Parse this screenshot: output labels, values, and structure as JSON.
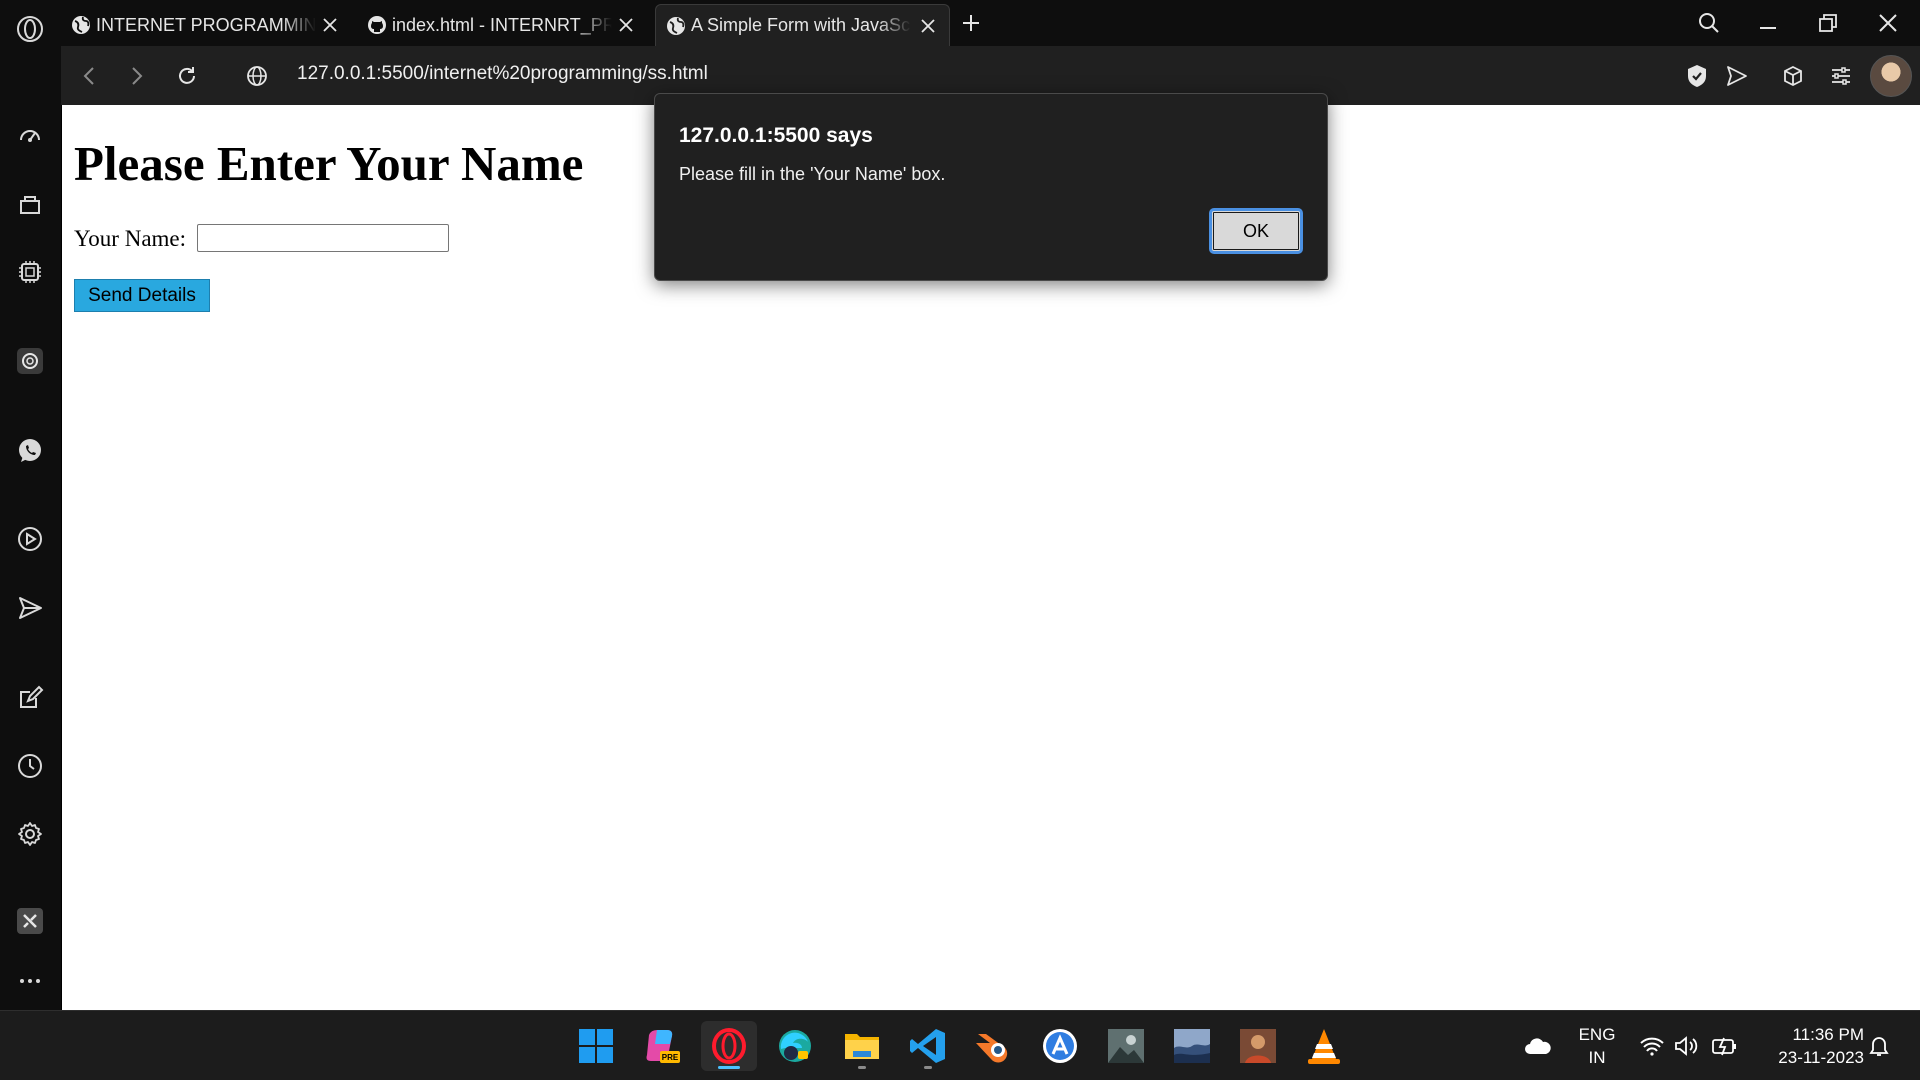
{
  "tabs": [
    {
      "title": "INTERNET PROGRAMMING",
      "favicon": "globe-icon",
      "active": false
    },
    {
      "title": "index.html - INTERNRT_PROGRAMMING",
      "favicon": "github-icon",
      "active": false
    },
    {
      "title": "A Simple Form with JavaScript",
      "favicon": "globe-icon",
      "active": true
    }
  ],
  "address": {
    "url_host": "127.0.0.1",
    "url_rest": ":5500/internet%20programming/ss.html"
  },
  "page": {
    "heading": "Please Enter Your Name",
    "name_label": "Your Name:",
    "name_value": "",
    "send_button": "Send Details"
  },
  "alert": {
    "title": "127.0.0.1:5500 says",
    "message": "Please fill in the 'Your Name' box.",
    "ok_label": "OK"
  },
  "sidebar": {
    "items": [
      "speed-dial-icon",
      "shopping-icon",
      "ai-chip-icon",
      "chatgpt-icon",
      "whatsapp-icon",
      "player-icon",
      "send-icon",
      "pinboard-icon",
      "history-icon",
      "settings-icon",
      "extensions-icon",
      "more-icon"
    ]
  },
  "taskbar": {
    "apps": [
      "windows-start",
      "copilot-preview",
      "opera",
      "edge-canary",
      "file-explorer",
      "vscode",
      "blender",
      "app-store",
      "photo-app-1",
      "photo-app-2",
      "photo-app-3",
      "vlc"
    ],
    "language_line1": "ENG",
    "language_line2": "IN",
    "time": "11:36 PM",
    "date": "23-11-2023"
  },
  "colors": {
    "accent_blue": "#29a8df",
    "focus_ring": "#4a90e2",
    "active_indicator": "#4cc2ff"
  }
}
